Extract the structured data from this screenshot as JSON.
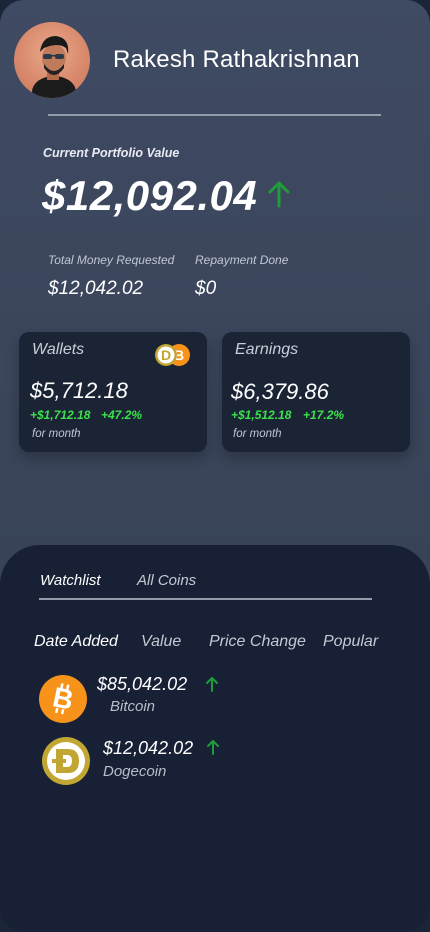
{
  "profile": {
    "name": "Rakesh Rathakrishnan"
  },
  "portfolio": {
    "label": "Current Portfolio Value",
    "value": "$12,092.04",
    "total_requested_label": "Total Money Requested",
    "total_requested_value": "$12,042.02",
    "repayment_label": "Repayment Done",
    "repayment_value": "$0"
  },
  "cards": [
    {
      "title": "Wallets",
      "value": "$5,712.18",
      "change_amount": "+$1,712.18",
      "change_pct": "+47.2%",
      "period": "for month"
    },
    {
      "title": "Earnings",
      "value": "$6,379.86",
      "change_amount": "+$1,512.18",
      "change_pct": "+17.2%",
      "period": "for month"
    }
  ],
  "tabs": [
    {
      "label": "Watchlist",
      "active": true
    },
    {
      "label": "All Coins",
      "active": false
    }
  ],
  "columns": [
    "Date Added",
    "Value",
    "Price Change",
    "Popular"
  ],
  "coins": [
    {
      "name": "Bitcoin",
      "price": "$85,042.02",
      "trend": "up",
      "icon": "bitcoin-icon"
    },
    {
      "name": "Dogecoin",
      "price": "$12,042.02",
      "trend": "up",
      "icon": "dogecoin-icon"
    }
  ],
  "colors": {
    "positive": "#3be24b",
    "arrow": "#1f9d3a",
    "bitcoin": "#f7931a",
    "dogecoin": "#c2a633"
  }
}
